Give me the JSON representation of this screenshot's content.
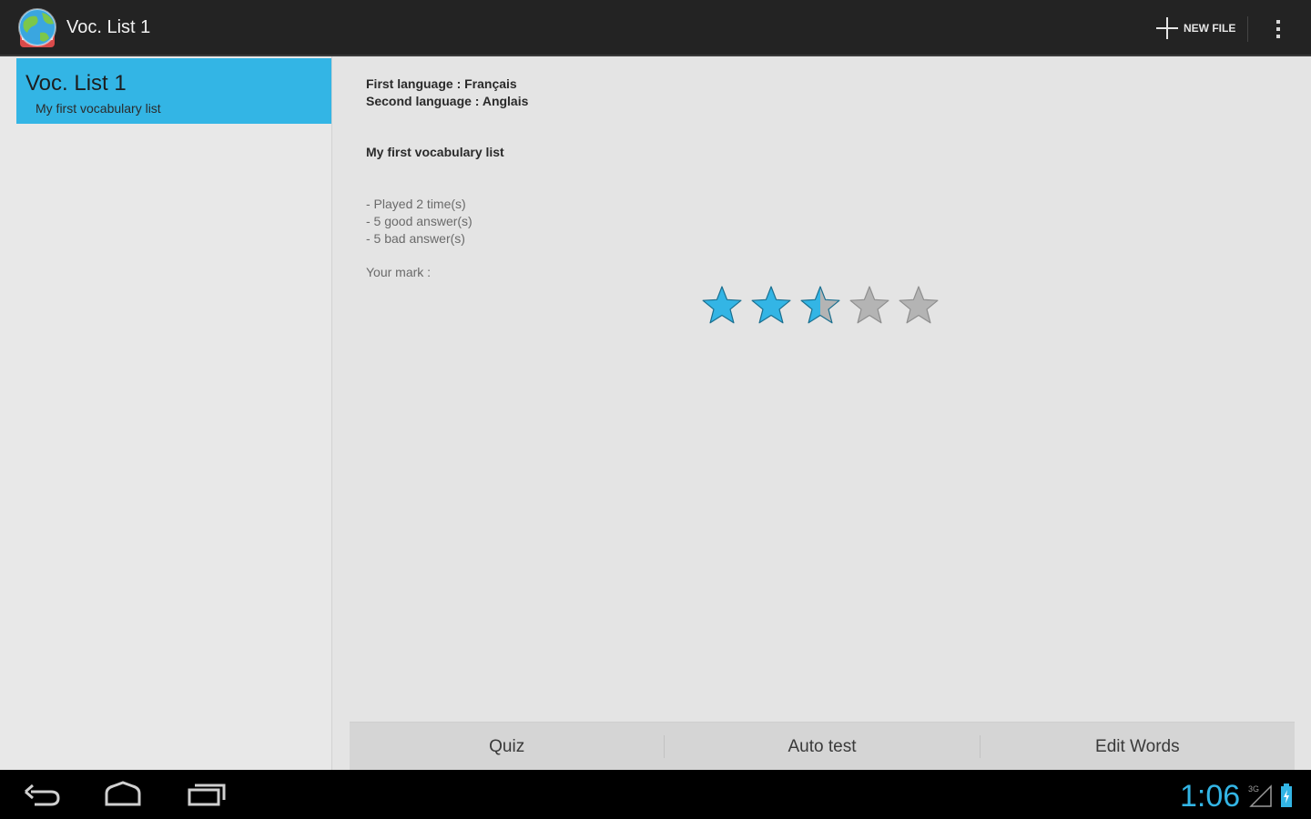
{
  "actionbar": {
    "title": "Voc. List 1",
    "new_file_label": "NEW FILE",
    "app_icon": "globe-book-icon",
    "overflow_icon": "overflow-menu-icon"
  },
  "list": {
    "items": [
      {
        "title": "Voc. List 1",
        "subtitle": "My first vocabulary list",
        "selected": true
      }
    ]
  },
  "detail": {
    "first_language": "First language : Français",
    "second_language": "Second language : Anglais",
    "description": "My first vocabulary list",
    "stats": [
      "- Played 2 time(s)",
      "- 5 good answer(s)",
      "- 5 bad answer(s)"
    ],
    "mark_label": "Your mark :",
    "rating": 2.5,
    "rating_max": 5
  },
  "buttons": {
    "quiz": "Quiz",
    "auto_test": "Auto test",
    "edit_words": "Edit Words"
  },
  "system": {
    "clock": "1:06",
    "network": "3G",
    "nav_icons": [
      "back-icon",
      "home-icon",
      "recent-apps-icon"
    ]
  },
  "colors": {
    "accent": "#33b5e5",
    "actionbar_bg": "#232323",
    "star_empty": "#b4b4b4"
  }
}
